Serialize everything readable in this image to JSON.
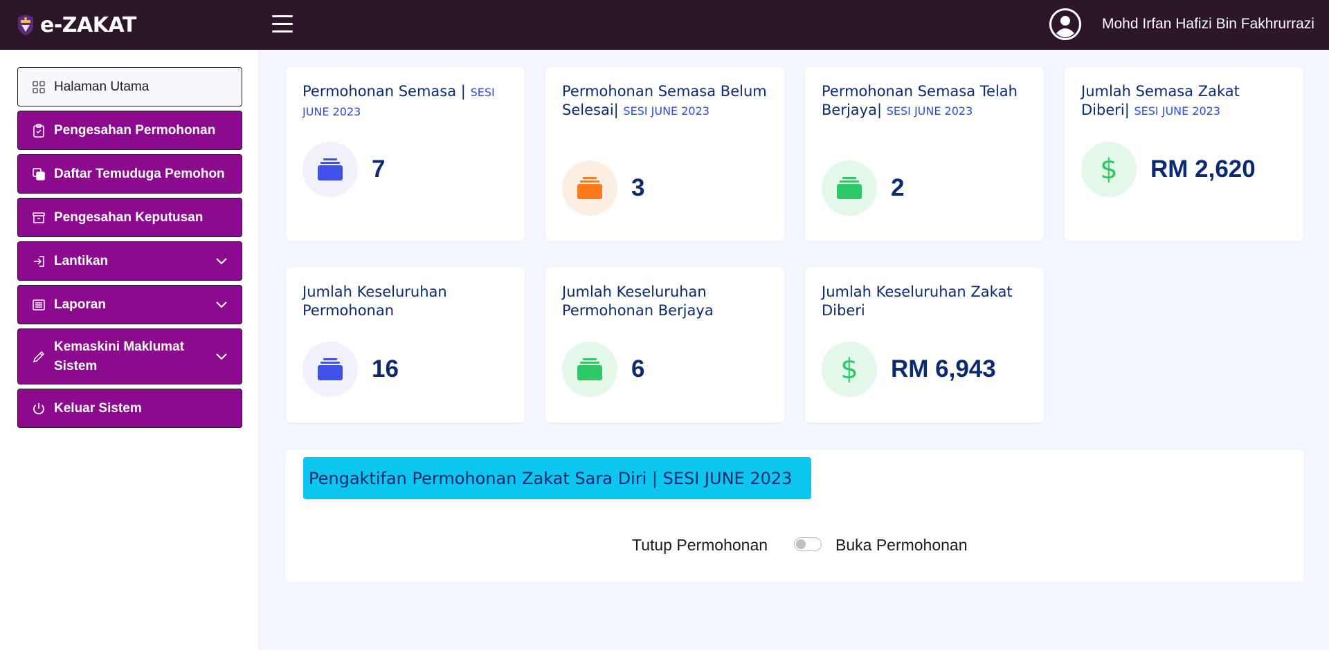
{
  "app": {
    "brand": "e-ZAKAT",
    "logo_icon": "university-crest-logo"
  },
  "header": {
    "menu_icon": "hamburger-icon",
    "user_icon": "user-avatar-icon",
    "user_name": "Mohd Irfan Hafizi Bin Fakhrurrazi"
  },
  "sidebar": {
    "items": [
      {
        "label": "Halaman Utama",
        "icon": "dashboard-grid-icon",
        "style": "active",
        "has_dropdown": false
      },
      {
        "label": "Pengesahan Permohonan",
        "icon": "clipboard-check-icon",
        "style": "purple",
        "has_dropdown": false
      },
      {
        "label": "Daftar Temuduga Pemohon",
        "icon": "copy-icon",
        "style": "purple",
        "has_dropdown": false
      },
      {
        "label": "Pengesahan Keputusan",
        "icon": "archive-icon",
        "style": "purple",
        "has_dropdown": false
      },
      {
        "label": "Lantikan",
        "icon": "login-icon",
        "style": "purple",
        "has_dropdown": true
      },
      {
        "label": "Laporan",
        "icon": "list-icon",
        "style": "purple",
        "has_dropdown": true
      },
      {
        "label": "Kemaskini Maklumat Sistem",
        "icon": "pencil-icon",
        "style": "purple",
        "has_dropdown": true
      },
      {
        "label": "Keluar Sistem",
        "icon": "power-icon",
        "style": "purple",
        "has_dropdown": false
      }
    ]
  },
  "cards": [
    {
      "title": "Permohonan Semasa |",
      "sesi": "SESI JUNE 2023",
      "value": "7",
      "icon": "inbox-stack-icon",
      "icon_color": "#3f51e8"
    },
    {
      "title": "Permohonan Semasa Belum Selesai|",
      "sesi": "SESI JUNE 2023",
      "value": "3",
      "icon": "inbox-stack-icon",
      "icon_color": "#fd7a1c"
    },
    {
      "title": "Permohonan Semasa Telah Berjaya|",
      "sesi": "SESI JUNE 2023",
      "value": "2",
      "icon": "inbox-stack-icon",
      "icon_color": "#2ec867"
    },
    {
      "title": "Jumlah Semasa Zakat Diberi|",
      "sesi": "SESI JUNE 2023",
      "value": "RM 2,620",
      "icon": "dollar-icon",
      "icon_color": "#2ec867"
    },
    {
      "title": "Jumlah Keseluruhan Permohonan",
      "sesi": "",
      "value": "16",
      "icon": "inbox-stack-icon",
      "icon_color": "#3f51e8"
    },
    {
      "title": "Jumlah Keseluruhan Permohonan Berjaya",
      "sesi": "",
      "value": "6",
      "icon": "inbox-stack-icon",
      "icon_color": "#2ec867"
    },
    {
      "title": "Jumlah Keseluruhan Zakat Diberi",
      "sesi": "",
      "value": "RM 6,943",
      "icon": "dollar-icon",
      "icon_color": "#2ec867"
    }
  ],
  "activation": {
    "banner": "Pengaktifan Permohonan Zakat Sara Diri | SESI JUNE 2023",
    "label_off": "Tutup Permohonan",
    "label_on": "Buka Permohonan",
    "toggle_on": false
  },
  "colors": {
    "topbar": "#2c1627",
    "sidebar_accent": "#8b0a8e",
    "banner": "#0dc6ef",
    "text_primary": "#0b2a6f"
  }
}
